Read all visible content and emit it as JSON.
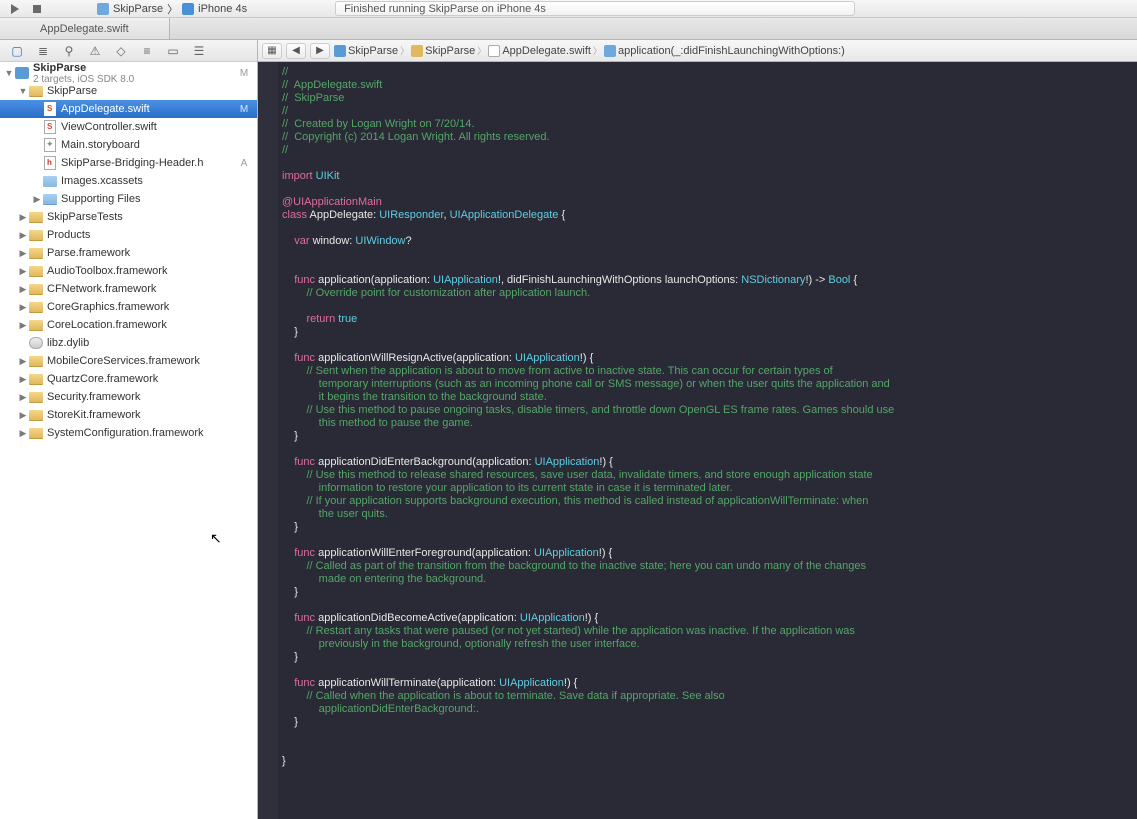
{
  "toolbar": {
    "scheme_app": "SkipParse",
    "scheme_device": "iPhone 4s",
    "status": "Finished running SkipParse on iPhone 4s"
  },
  "tabbar": {
    "active_tab": "AppDelegate.swift"
  },
  "project": {
    "name": "SkipParse",
    "subtitle": "2 targets, iOS SDK 8.0",
    "badge": "M"
  },
  "tree": [
    {
      "indent": 0,
      "disc": "▼",
      "icon": "folder-y",
      "label": "SkipParse",
      "badge": ""
    },
    {
      "indent": 1,
      "disc": "",
      "icon": "swift",
      "label": "AppDelegate.swift",
      "badge": "M",
      "selected": true
    },
    {
      "indent": 1,
      "disc": "",
      "icon": "swift",
      "label": "ViewController.swift",
      "badge": ""
    },
    {
      "indent": 1,
      "disc": "",
      "icon": "sb",
      "label": "Main.storyboard",
      "badge": ""
    },
    {
      "indent": 1,
      "disc": "",
      "icon": "h",
      "label": "SkipParse-Bridging-Header.h",
      "badge": "A"
    },
    {
      "indent": 1,
      "disc": "",
      "icon": "xc",
      "label": "Images.xcassets",
      "badge": ""
    },
    {
      "indent": 1,
      "disc": "▶",
      "icon": "folder",
      "label": "Supporting Files",
      "badge": ""
    },
    {
      "indent": 0,
      "disc": "▶",
      "icon": "folder-y",
      "label": "SkipParseTests",
      "badge": ""
    },
    {
      "indent": 0,
      "disc": "▶",
      "icon": "folder-y",
      "label": "Products",
      "badge": ""
    },
    {
      "indent": 0,
      "disc": "▶",
      "icon": "folder-y",
      "label": "Parse.framework",
      "badge": ""
    },
    {
      "indent": 0,
      "disc": "▶",
      "icon": "folder-y",
      "label": "AudioToolbox.framework",
      "badge": ""
    },
    {
      "indent": 0,
      "disc": "▶",
      "icon": "folder-y",
      "label": "CFNetwork.framework",
      "badge": ""
    },
    {
      "indent": 0,
      "disc": "▶",
      "icon": "folder-y",
      "label": "CoreGraphics.framework",
      "badge": ""
    },
    {
      "indent": 0,
      "disc": "▶",
      "icon": "folder-y",
      "label": "CoreLocation.framework",
      "badge": ""
    },
    {
      "indent": 0,
      "disc": "",
      "icon": "dylib",
      "label": "libz.dylib",
      "badge": ""
    },
    {
      "indent": 0,
      "disc": "▶",
      "icon": "folder-y",
      "label": "MobileCoreServices.framework",
      "badge": ""
    },
    {
      "indent": 0,
      "disc": "▶",
      "icon": "folder-y",
      "label": "QuartzCore.framework",
      "badge": ""
    },
    {
      "indent": 0,
      "disc": "▶",
      "icon": "folder-y",
      "label": "Security.framework",
      "badge": ""
    },
    {
      "indent": 0,
      "disc": "▶",
      "icon": "folder-y",
      "label": "StoreKit.framework",
      "badge": ""
    },
    {
      "indent": 0,
      "disc": "▶",
      "icon": "folder-y",
      "label": "SystemConfiguration.framework",
      "badge": ""
    }
  ],
  "jumpbar": {
    "0": "SkipParse",
    "1": "SkipParse",
    "2": "AppDelegate.swift",
    "3": "application(_:didFinishLaunchingWithOptions:)"
  },
  "code": {
    "lines": [
      {
        "t": "comment",
        "s": "//"
      },
      {
        "t": "comment",
        "s": "//  AppDelegate.swift"
      },
      {
        "t": "comment",
        "s": "//  SkipParse"
      },
      {
        "t": "comment",
        "s": "//"
      },
      {
        "t": "comment",
        "s": "//  Created by Logan Wright on 7/20/14."
      },
      {
        "t": "comment",
        "s": "//  Copyright (c) 2014 Logan Wright. All rights reserved."
      },
      {
        "t": "comment",
        "s": "//"
      },
      {
        "t": "blank",
        "s": ""
      },
      {
        "t": "import",
        "kw": "import",
        "id": "UIKit"
      },
      {
        "t": "blank",
        "s": ""
      },
      {
        "t": "attr",
        "s": "@UIApplicationMain"
      },
      {
        "t": "classdecl",
        "kw": "class",
        "name": "AppDelegate",
        "sup1": "UIResponder",
        "sup2": "UIApplicationDelegate",
        "tail": " {"
      },
      {
        "t": "blank",
        "s": ""
      },
      {
        "t": "vardecl",
        "indent": "    ",
        "kw": "var",
        "name": "window",
        "type": "UIWindow",
        "opt": "?"
      },
      {
        "t": "blank",
        "s": ""
      },
      {
        "t": "blank",
        "s": ""
      },
      {
        "t": "funcdecl1",
        "indent": "    ",
        "kw": "func",
        "name": "application",
        "p1": "(application: ",
        "t1": "UIApplication",
        "b1": "!, didFinishLaunchingWithOptions launchOptions: ",
        "t2": "NSDictionary",
        "b2": "!) -> ",
        "ret": "Bool",
        "tail": " {"
      },
      {
        "t": "comment",
        "s": "        // Override point for customization after application launch."
      },
      {
        "t": "blank",
        "s": ""
      },
      {
        "t": "return",
        "indent": "        ",
        "kw": "return",
        "val": "true"
      },
      {
        "t": "plain",
        "s": "    }"
      },
      {
        "t": "blank",
        "s": ""
      },
      {
        "t": "funcdecl2",
        "indent": "    ",
        "kw": "func",
        "name": "applicationWillResignActive",
        "p1": "(application: ",
        "t1": "UIApplication",
        "b1": "!) {"
      },
      {
        "t": "comment",
        "s": "        // Sent when the application is about to move from active to inactive state. This can occur for certain types of"
      },
      {
        "t": "comment",
        "s": "            temporary interruptions (such as an incoming phone call or SMS message) or when the user quits the application and"
      },
      {
        "t": "comment",
        "s": "            it begins the transition to the background state."
      },
      {
        "t": "comment",
        "s": "        // Use this method to pause ongoing tasks, disable timers, and throttle down OpenGL ES frame rates. Games should use"
      },
      {
        "t": "comment",
        "s": "            this method to pause the game."
      },
      {
        "t": "plain",
        "s": "    }"
      },
      {
        "t": "blank",
        "s": ""
      },
      {
        "t": "funcdecl2",
        "indent": "    ",
        "kw": "func",
        "name": "applicationDidEnterBackground",
        "p1": "(application: ",
        "t1": "UIApplication",
        "b1": "!) {"
      },
      {
        "t": "comment",
        "s": "        // Use this method to release shared resources, save user data, invalidate timers, and store enough application state"
      },
      {
        "t": "comment",
        "s": "            information to restore your application to its current state in case it is terminated later."
      },
      {
        "t": "comment",
        "s": "        // If your application supports background execution, this method is called instead of applicationWillTerminate: when"
      },
      {
        "t": "comment",
        "s": "            the user quits."
      },
      {
        "t": "plain",
        "s": "    }"
      },
      {
        "t": "blank",
        "s": ""
      },
      {
        "t": "funcdecl2",
        "indent": "    ",
        "kw": "func",
        "name": "applicationWillEnterForeground",
        "p1": "(application: ",
        "t1": "UIApplication",
        "b1": "!) {"
      },
      {
        "t": "comment",
        "s": "        // Called as part of the transition from the background to the inactive state; here you can undo many of the changes"
      },
      {
        "t": "comment",
        "s": "            made on entering the background."
      },
      {
        "t": "plain",
        "s": "    }"
      },
      {
        "t": "blank",
        "s": ""
      },
      {
        "t": "funcdecl2",
        "indent": "    ",
        "kw": "func",
        "name": "applicationDidBecomeActive",
        "p1": "(application: ",
        "t1": "UIApplication",
        "b1": "!) {"
      },
      {
        "t": "comment",
        "s": "        // Restart any tasks that were paused (or not yet started) while the application was inactive. If the application was"
      },
      {
        "t": "comment",
        "s": "            previously in the background, optionally refresh the user interface."
      },
      {
        "t": "plain",
        "s": "    }"
      },
      {
        "t": "blank",
        "s": ""
      },
      {
        "t": "funcdecl2",
        "indent": "    ",
        "kw": "func",
        "name": "applicationWillTerminate",
        "p1": "(application: ",
        "t1": "UIApplication",
        "b1": "!) {"
      },
      {
        "t": "comment",
        "s": "        // Called when the application is about to terminate. Save data if appropriate. See also"
      },
      {
        "t": "comment",
        "s": "            applicationDidEnterBackground:."
      },
      {
        "t": "plain",
        "s": "    }"
      },
      {
        "t": "blank",
        "s": ""
      },
      {
        "t": "blank",
        "s": ""
      },
      {
        "t": "plain",
        "s": "}"
      }
    ]
  }
}
